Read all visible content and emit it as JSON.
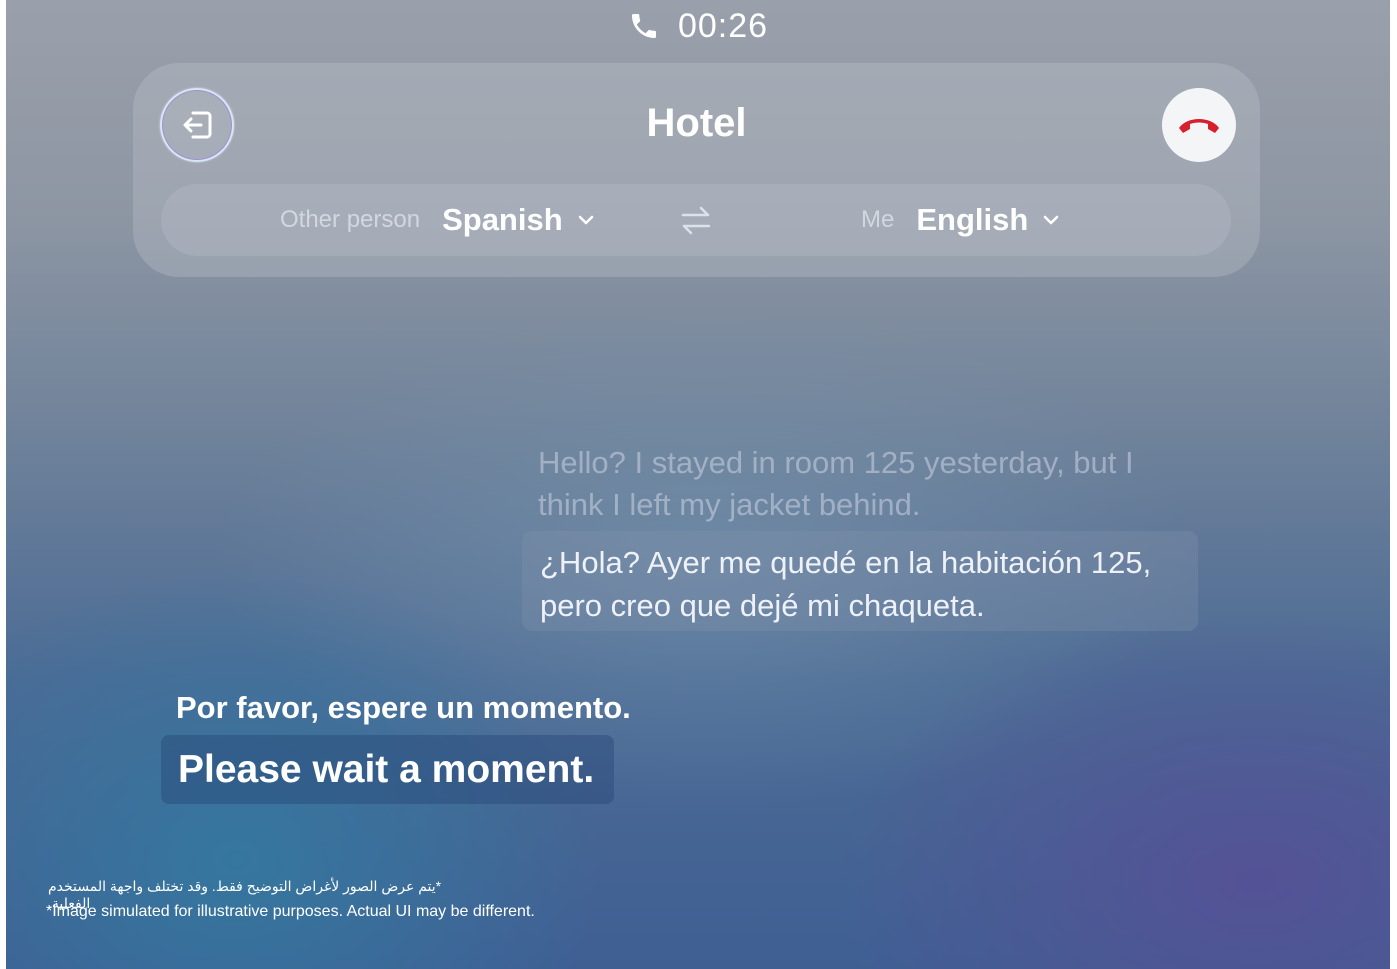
{
  "status": {
    "timer": "00:26",
    "icon": "phone-icon"
  },
  "header": {
    "title": "Hotel",
    "back_icon": "exit-icon",
    "end_call_icon": "end-call-icon"
  },
  "languages": {
    "other_label": "Other person",
    "other_value": "Spanish",
    "me_label": "Me",
    "me_value": "English",
    "swap_icon": "swap-icon"
  },
  "conversation": {
    "incoming_original": "Hello? I stayed in room 125 yesterday, but I think I left my jacket behind.",
    "incoming_translation": "¿Hola? Ayer me quedé en la habitación 125, pero creo que dejé mi chaqueta.",
    "reply_translation": "Por favor, espere un momento.",
    "reply_original": "Please wait a moment."
  },
  "disclaimer": {
    "arabic": "*يتم عرض الصور لأغراض التوضيح فقط. وقد تختلف واجهة المستخدم الفعلية.",
    "english": "*Image simulated for illustrative purposes. Actual UI may be different."
  },
  "colors": {
    "end_call_red": "#d8202c",
    "card_bg": "#c8cdd4"
  }
}
